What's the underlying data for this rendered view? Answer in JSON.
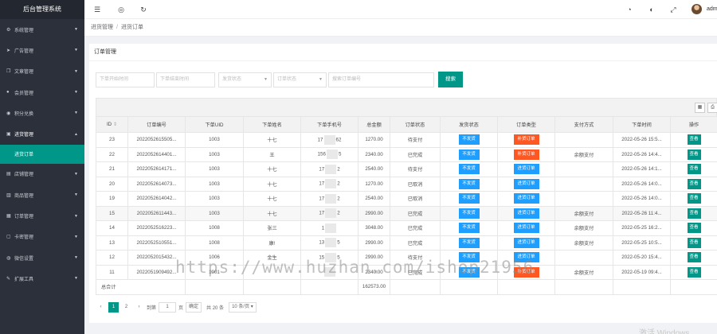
{
  "app_title": "后台管理系统",
  "sidebar": {
    "items": [
      {
        "label": "系统管理",
        "icon": "gear-icon"
      },
      {
        "label": "广告管理",
        "icon": "send-icon"
      },
      {
        "label": "文章管理",
        "icon": "copy-icon"
      },
      {
        "label": "会员管理",
        "icon": "user-icon"
      },
      {
        "label": "积分兑换",
        "icon": "lock-icon"
      },
      {
        "label": "进货管理",
        "icon": "cart-icon"
      },
      {
        "label": "店铺管理",
        "icon": "shop-icon"
      },
      {
        "label": "商品管理",
        "icon": "chart-icon"
      },
      {
        "label": "订单管理",
        "icon": "grid-icon"
      },
      {
        "label": "卡密管理",
        "icon": "card-icon"
      },
      {
        "label": "微信设置",
        "icon": "wechat-icon"
      },
      {
        "label": "扩展工具",
        "icon": "wrench-icon"
      }
    ],
    "open_sub": "进货订单"
  },
  "topbar": {
    "user": "adm"
  },
  "breadcrumb": {
    "parent": "进货管理",
    "sep": "/",
    "current": "进货订单"
  },
  "card": {
    "title": "订单管理"
  },
  "filters": {
    "start": "下单开始时间",
    "end": "下单结束时间",
    "ship": "发货状态",
    "order": "订单状态",
    "no": "搜索订单编号",
    "search_btn": "搜索"
  },
  "table": {
    "headers": [
      "ID",
      "订单编号",
      "下单UID",
      "下单姓名",
      "下单手机号",
      "总金额",
      "订单状态",
      "发货状态",
      "订单类型",
      "支付方式",
      "下单时间",
      "操作"
    ],
    "rows": [
      {
        "id": "23",
        "no": "2022052615505...",
        "uid": "1003",
        "name": "十七",
        "ph_a": "17",
        "ph_b": "62",
        "amt": "1270.00",
        "st": "待支付",
        "ship": "不发货",
        "type": "补货订单",
        "tc": "red",
        "pay": "",
        "time": "2022-05-26 15:5...",
        "op": "查看"
      },
      {
        "id": "22",
        "no": "2022052614401...",
        "uid": "1003",
        "name": "王",
        "ph_a": "156",
        "ph_b": "5",
        "amt": "2340.00",
        "st": "已完成",
        "ship": "不发货",
        "type": "补货订单",
        "tc": "red",
        "pay": "余额支付",
        "time": "2022-05-26 14:4...",
        "op": "查看"
      },
      {
        "id": "21",
        "no": "2022052614171...",
        "uid": "1003",
        "name": "十七",
        "ph_a": "17",
        "ph_b": "2",
        "amt": "2540.00",
        "st": "待支付",
        "ship": "不发货",
        "type": "进货订单",
        "tc": "blue",
        "pay": "",
        "time": "2022-05-26 14:1...",
        "op": "查看"
      },
      {
        "id": "20",
        "no": "2022052614073...",
        "uid": "1003",
        "name": "十七",
        "ph_a": "17",
        "ph_b": "2",
        "amt": "1270.00",
        "st": "已取消",
        "ship": "不发货",
        "type": "进货订单",
        "tc": "blue",
        "pay": "",
        "time": "2022-05-26 14:0...",
        "op": "查看"
      },
      {
        "id": "19",
        "no": "2022052614042...",
        "uid": "1003",
        "name": "十七",
        "ph_a": "17",
        "ph_b": "2",
        "amt": "2540.00",
        "st": "已取消",
        "ship": "不发货",
        "type": "进货订单",
        "tc": "blue",
        "pay": "",
        "time": "2022-05-26 14:0...",
        "op": "查看"
      },
      {
        "id": "15",
        "no": "2022052611443...",
        "uid": "1003",
        "name": "十七",
        "ph_a": "17",
        "ph_b": "2",
        "amt": "2990.00",
        "st": "已完成",
        "ship": "不发货",
        "type": "进货订单",
        "tc": "blue",
        "pay": "余额支付",
        "time": "2022-05-26 11:4...",
        "op": "查看"
      },
      {
        "id": "14",
        "no": "2022052516223...",
        "uid": "1008",
        "name": "张三",
        "ph_a": "1",
        "ph_b": "",
        "amt": "3048.00",
        "st": "已完成",
        "ship": "不发货",
        "type": "进货订单",
        "tc": "blue",
        "pay": "余额支付",
        "time": "2022-05-25 16:2...",
        "op": "查看"
      },
      {
        "id": "13",
        "no": "2022052510551...",
        "uid": "1008",
        "name": "康!",
        "ph_a": "13",
        "ph_b": "5",
        "amt": "2990.00",
        "st": "已完成",
        "ship": "不发货",
        "type": "进货订单",
        "tc": "blue",
        "pay": "余额支付",
        "time": "2022-05-25 10:5...",
        "op": "查看"
      },
      {
        "id": "12",
        "no": "2022052015432...",
        "uid": "1006",
        "name": "金生",
        "ph_a": "15",
        "ph_b": "5",
        "amt": "2990.00",
        "st": "待支付",
        "ship": "不发货",
        "type": "进货订单",
        "tc": "blue",
        "pay": "",
        "time": "2022-05-20 15:4...",
        "op": "查看"
      },
      {
        "id": "11",
        "no": "2022051909492...",
        "uid": "1001",
        "name": "",
        "ph_a": "",
        "ph_b": "",
        "amt": "2340.00",
        "st": "已完成",
        "ship": "不发货",
        "type": "补货订单",
        "tc": "red",
        "pay": "余额支付",
        "time": "2022-05-19 09:4...",
        "op": "查看"
      }
    ],
    "total_label": "总合计",
    "total_amount": "162573.00"
  },
  "pager": {
    "prev": "‹",
    "p1": "1",
    "p2": "2",
    "next": "›",
    "goto": "到第",
    "page_no": "1",
    "page_unit": "页",
    "confirm": "确定",
    "total": "共 20 条",
    "per_page": "10 条/页"
  },
  "watermark": "https://www.huzhan.com/ishop21956",
  "os_notice": "激活 Windows"
}
